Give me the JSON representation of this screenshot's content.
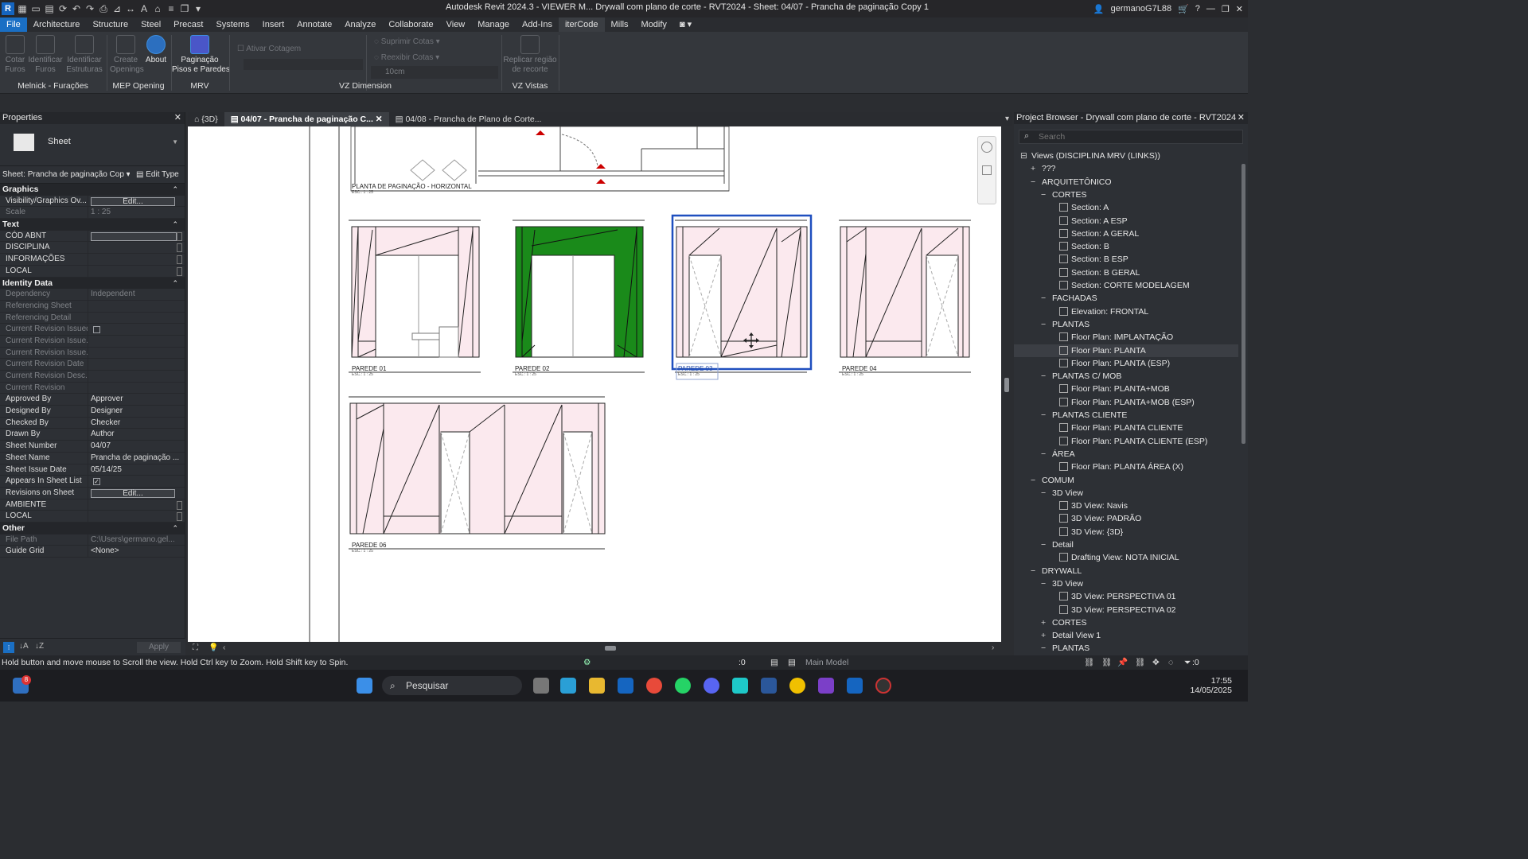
{
  "titlebar": {
    "title": "Autodesk Revit 2024.3 - VIEWER M... Drywall com plano de corte - RVT2024 - Sheet: 04/07 - Prancha de paginação Copy 1",
    "user": "germanoG7L88"
  },
  "ribbon_tabs": [
    "File",
    "Architecture",
    "Structure",
    "Steel",
    "Precast",
    "Systems",
    "Insert",
    "Annotate",
    "Analyze",
    "Collaborate",
    "View",
    "Manage",
    "Add-Ins",
    "iterCode",
    "Mills",
    "Modify"
  ],
  "ribbon": {
    "buttons": [
      {
        "label": "Cotar\nFuros"
      },
      {
        "label": "Identificar\nFuros"
      },
      {
        "label": "Identificar\nEstruturas"
      },
      {
        "label": "Create\nOpenings"
      },
      {
        "label": "About"
      },
      {
        "label": "Paginação\nPisos e Paredes"
      },
      {
        "label": "Replicar região\nde recorte"
      }
    ],
    "small": [
      "Ativar Cotagem",
      "Suprimir Cotas",
      "Reexibir Cotas",
      "10cm"
    ],
    "panels": [
      "Melnick - Furações",
      "MEP Opening",
      "MRV",
      "VZ Dimension",
      "VZ Vistas"
    ]
  },
  "properties": {
    "title": "Properties",
    "type_name": "Sheet",
    "instance": "Sheet: Prancha de paginação Cop",
    "edit_type": "Edit Type",
    "groups": {
      "graphics": "Graphics",
      "text": "Text",
      "identity": "Identity Data",
      "other": "Other"
    },
    "rows": {
      "vis_k": "Visibility/Graphics Ov...",
      "vis_v": "Edit...",
      "scale_k": "Scale",
      "scale_v": "1 : 25",
      "cod_k": "CÓD ABNT",
      "disc_k": "DISCIPLINA",
      "info_k": "INFORMAÇÕES",
      "local_k": "LOCAL",
      "dep_k": "Dependency",
      "dep_v": "Independent",
      "refs_k": "Referencing Sheet",
      "refd_k": "Referencing Detail",
      "cri_k": "Current Revision Issued",
      "crib_k": "Current Revision Issue...",
      "crit_k": "Current Revision Issue...",
      "crd_k": "Current Revision Date",
      "crdesc_k": "Current Revision Desc...",
      "cr_k": "Current Revision",
      "appr_k": "Approved By",
      "appr_v": "Approver",
      "des_k": "Designed By",
      "des_v": "Designer",
      "chk_k": "Checked By",
      "chk_v": "Checker",
      "drawn_k": "Drawn By",
      "drawn_v": "Author",
      "num_k": "Sheet Number",
      "num_v": "04/07",
      "name_k": "Sheet Name",
      "name_v": "Prancha de paginação ...",
      "date_k": "Sheet Issue Date",
      "date_v": "05/14/25",
      "list_k": "Appears In Sheet List",
      "revs_k": "Revisions on Sheet",
      "revs_v": "Edit...",
      "amb_k": "AMBIENTE",
      "local2_k": "LOCAL",
      "path_k": "File Path",
      "path_v": "C:\\Users\\germano.gel...",
      "grid_k": "Guide Grid",
      "grid_v": "<None>"
    },
    "apply": "Apply"
  },
  "view_tabs": [
    "{3D}",
    "04/07 - Prancha de paginação C...",
    "04/08 - Prancha de Plano de Corte..."
  ],
  "drawing": {
    "plan_label": "PLANTA DE PAGINAÇÃO - HORIZONTAL",
    "scale": "ESC.: 1 : 25",
    "walls": [
      "PAREDE 01",
      "PAREDE 02",
      "PAREDE 03",
      "PAREDE 04",
      "PAREDE 06"
    ],
    "tag": "PAREDE 06",
    "colors": {
      "pink": "#fbe9ee",
      "green": "#1a8a1a",
      "select": "#1f4fbf"
    }
  },
  "browser": {
    "title": "Project Browser - Drywall com plano de corte - RVT2024",
    "search_placeholder": "Search",
    "nodes": [
      {
        "t": "Views (DISCIPLINA MRV (LINKS))",
        "lvl": 0,
        "exp": "⊟"
      },
      {
        "t": "???",
        "lvl": 1,
        "exp": "+"
      },
      {
        "t": "ARQUITETÔNICO",
        "lvl": 1,
        "exp": "−"
      },
      {
        "t": "CORTES",
        "lvl": 2,
        "exp": "−"
      },
      {
        "t": "Section: A",
        "lvl": 3,
        "v": true
      },
      {
        "t": "Section: A ESP",
        "lvl": 3,
        "v": true
      },
      {
        "t": "Section: A GERAL",
        "lvl": 3,
        "v": true
      },
      {
        "t": "Section: B",
        "lvl": 3,
        "v": true
      },
      {
        "t": "Section: B ESP",
        "lvl": 3,
        "v": true
      },
      {
        "t": "Section: B GERAL",
        "lvl": 3,
        "v": true
      },
      {
        "t": "Section: CORTE MODELAGEM",
        "lvl": 3,
        "v": true
      },
      {
        "t": "FACHADAS",
        "lvl": 2,
        "exp": "−"
      },
      {
        "t": "Elevation: FRONTAL",
        "lvl": 3,
        "v": true
      },
      {
        "t": "PLANTAS",
        "lvl": 2,
        "exp": "−"
      },
      {
        "t": "Floor Plan: IMPLANTAÇÃO",
        "lvl": 3,
        "v": true
      },
      {
        "t": "Floor Plan: PLANTA",
        "lvl": 3,
        "v": true,
        "sel": true
      },
      {
        "t": "Floor Plan: PLANTA (ESP)",
        "lvl": 3,
        "v": true
      },
      {
        "t": "PLANTAS C/ MOB",
        "lvl": 2,
        "exp": "−"
      },
      {
        "t": "Floor Plan: PLANTA+MOB",
        "lvl": 3,
        "v": true
      },
      {
        "t": "Floor Plan: PLANTA+MOB (ESP)",
        "lvl": 3,
        "v": true
      },
      {
        "t": "PLANTAS CLIENTE",
        "lvl": 2,
        "exp": "−"
      },
      {
        "t": "Floor Plan: PLANTA CLIENTE",
        "lvl": 3,
        "v": true
      },
      {
        "t": "Floor Plan: PLANTA CLIENTE (ESP)",
        "lvl": 3,
        "v": true
      },
      {
        "t": "ÁREA",
        "lvl": 2,
        "exp": "−"
      },
      {
        "t": "Floor Plan: PLANTA ÁREA (X)",
        "lvl": 3,
        "v": true
      },
      {
        "t": "COMUM",
        "lvl": 1,
        "exp": "−"
      },
      {
        "t": "3D View",
        "lvl": 2,
        "exp": "−"
      },
      {
        "t": "3D View: Navis",
        "lvl": 3,
        "v": true
      },
      {
        "t": "3D View: PADRÃO",
        "lvl": 3,
        "v": true
      },
      {
        "t": "3D View: {3D}",
        "lvl": 3,
        "v": true
      },
      {
        "t": "Detail",
        "lvl": 2,
        "exp": "−"
      },
      {
        "t": "Drafting View: NOTA INICIAL",
        "lvl": 3,
        "v": true
      },
      {
        "t": "DRYWALL",
        "lvl": 1,
        "exp": "−"
      },
      {
        "t": "3D View",
        "lvl": 2,
        "exp": "−"
      },
      {
        "t": "3D View: PERSPECTIVA 01",
        "lvl": 3,
        "v": true
      },
      {
        "t": "3D View: PERSPECTIVA 02",
        "lvl": 3,
        "v": true
      },
      {
        "t": "CORTES",
        "lvl": 2,
        "exp": "+"
      },
      {
        "t": "Detail View 1",
        "lvl": 2,
        "exp": "+"
      },
      {
        "t": "PLANTAS",
        "lvl": 2,
        "exp": "−"
      }
    ]
  },
  "statusbar": {
    "hint": "Hold button and move mouse to Scroll the view. Hold Ctrl key to Zoom. Hold Shift key to Spin.",
    "count": ":0",
    "model": "Main Model",
    "filter": ":0"
  },
  "taskbar": {
    "search": "Pesquisar",
    "time": "17:55",
    "date": "14/05/2025",
    "badge": "8"
  }
}
